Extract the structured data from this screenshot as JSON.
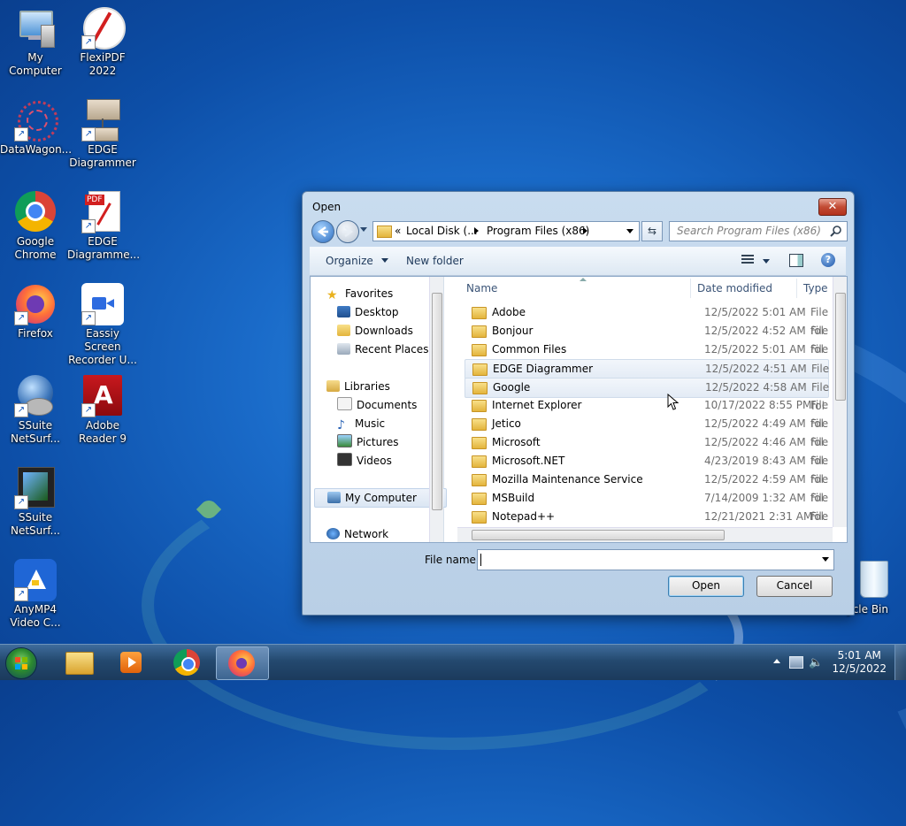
{
  "desktop": {
    "icons": [
      {
        "label": "My Computer"
      },
      {
        "label": "FlexiPDF 2022"
      },
      {
        "label": "DataWagon..."
      },
      {
        "label": "EDGE Diagrammer"
      },
      {
        "label": "Google Chrome"
      },
      {
        "label": "EDGE Diagramme..."
      },
      {
        "label": "Firefox"
      },
      {
        "label": "Eassiy Screen Recorder U..."
      },
      {
        "label": "SSuite NetSurf..."
      },
      {
        "label": "Adobe Reader 9"
      },
      {
        "label": "SSuite NetSurf..."
      },
      {
        "label": "AnyMP4 Video C..."
      },
      {
        "label": "ycle Bin"
      }
    ],
    "pdf_badge": "PDF"
  },
  "dialog": {
    "title": "Open",
    "close_glyph": "✕",
    "address": {
      "chevrons": "«",
      "seg1": "Local Disk (...",
      "seg2": "Program Files (x86)"
    },
    "search_placeholder": "Search Program Files (x86)",
    "toolbar": {
      "organize": "Organize",
      "new_folder": "New folder"
    },
    "nav": {
      "favorites": "Favorites",
      "desktop": "Desktop",
      "downloads": "Downloads",
      "recent": "Recent Places",
      "libraries": "Libraries",
      "documents": "Documents",
      "music": "Music",
      "pictures": "Pictures",
      "videos": "Videos",
      "computer": "My Computer",
      "network": "Network"
    },
    "columns": {
      "name": "Name",
      "date": "Date modified",
      "type": "Type"
    },
    "files": [
      {
        "name": "Adobe",
        "date": "12/5/2022 5:01 AM",
        "type": "File fol"
      },
      {
        "name": "Bonjour",
        "date": "12/5/2022 4:52 AM",
        "type": "File fol"
      },
      {
        "name": "Common Files",
        "date": "12/5/2022 5:01 AM",
        "type": "File fol"
      },
      {
        "name": "EDGE Diagrammer",
        "date": "12/5/2022 4:51 AM",
        "type": "File fol"
      },
      {
        "name": "Google",
        "date": "12/5/2022 4:58 AM",
        "type": "File fol"
      },
      {
        "name": "Internet Explorer",
        "date": "10/17/2022 8:55 PM",
        "type": "File fol"
      },
      {
        "name": "Jetico",
        "date": "12/5/2022 4:49 AM",
        "type": "File fol"
      },
      {
        "name": "Microsoft",
        "date": "12/5/2022 4:46 AM",
        "type": "File fol"
      },
      {
        "name": "Microsoft.NET",
        "date": "4/23/2019 8:43 AM",
        "type": "File fol"
      },
      {
        "name": "Mozilla Maintenance Service",
        "date": "12/5/2022 4:59 AM",
        "type": "File fol"
      },
      {
        "name": "MSBuild",
        "date": "7/14/2009 1:32 AM",
        "type": "File fol"
      },
      {
        "name": "Notepad++",
        "date": "12/21/2021 2:31 AM",
        "type": "File fol"
      }
    ],
    "file_name_label": "File name:",
    "file_name_value": "",
    "open_button": "Open",
    "cancel_button": "Cancel"
  },
  "taskbar": {
    "time": "5:01 AM",
    "date": "12/5/2022"
  },
  "colors": {
    "accent": "#1a6bc9",
    "close": "#c24b34"
  }
}
